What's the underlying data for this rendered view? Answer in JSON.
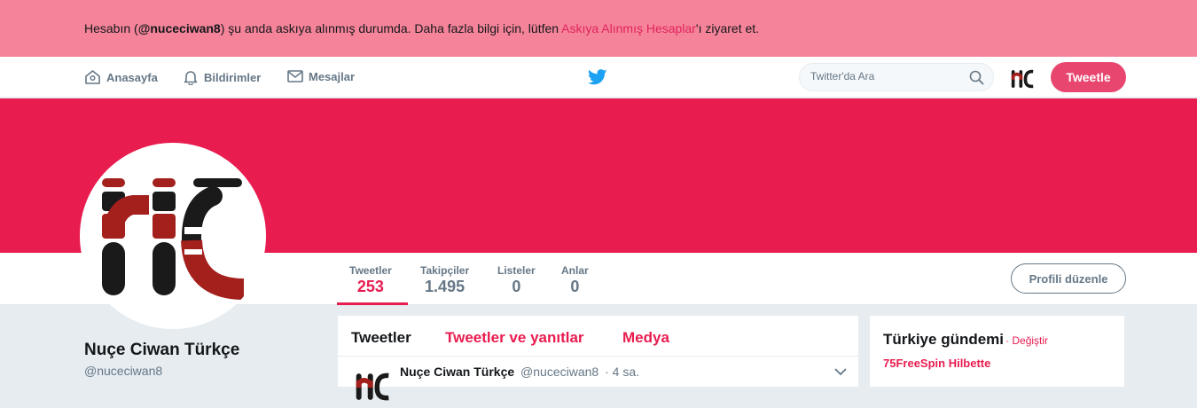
{
  "banner": {
    "prefix": "Hesabın (",
    "handle": "@nuceciwan8",
    "middle": ") şu anda askıya alınmış durumda. Daha fazla bilgi için, lütfen ",
    "link": "Askıya Alınmış Hesaplar",
    "suffix": "'ı ziyaret et."
  },
  "nav": {
    "home": "Anasayfa",
    "notifications": "Bildirimler",
    "messages": "Mesajlar",
    "search_placeholder": "Twitter'da Ara",
    "tweet_button": "Tweetle"
  },
  "stats": [
    {
      "label": "Tweetler",
      "value": "253"
    },
    {
      "label": "Takipçiler",
      "value": "1.495"
    },
    {
      "label": "Listeler",
      "value": "0"
    },
    {
      "label": "Anlar",
      "value": "0"
    }
  ],
  "edit_profile": "Profili düzenle",
  "profile": {
    "name": "Nuçe Ciwan Türkçe",
    "handle": "@nuceciwan8"
  },
  "timeline": {
    "tabs": [
      "Tweetler",
      "Tweetler ve yanıtlar",
      "Medya"
    ],
    "tweet": {
      "name": "Nuçe Ciwan Türkçe",
      "handle": "@nuceciwan8",
      "time": "· 4 sa."
    }
  },
  "trends": {
    "title": "Türkiye gündemi",
    "change": "· Değiştir",
    "items": [
      "75FreeSpin Hilbette"
    ]
  },
  "colors": {
    "accent": "#e81c4f",
    "banner": "#f5849a",
    "header": "#e81c4f"
  }
}
